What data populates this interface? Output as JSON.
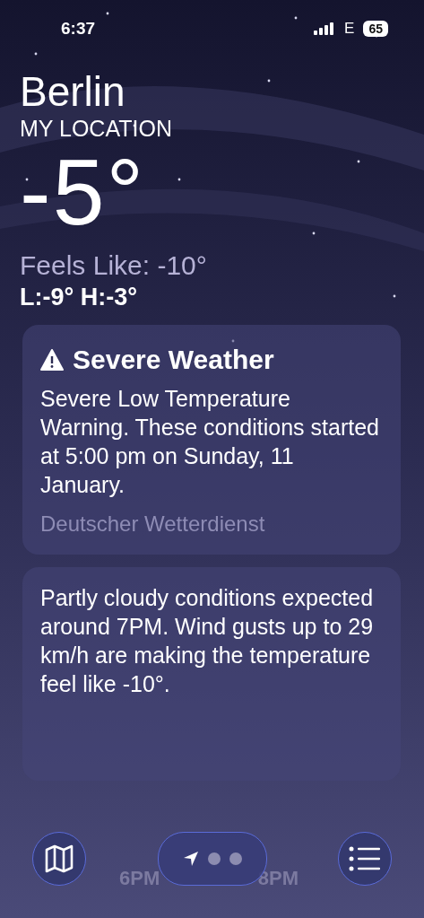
{
  "status_bar": {
    "time": "6:37",
    "network": "E",
    "battery": "65"
  },
  "location": {
    "city": "Berlin",
    "label": "MY LOCATION",
    "temperature": "-5°",
    "feels_like": "Feels Like: -10°",
    "low_high": "L:-9° H:-3°"
  },
  "alert_card": {
    "title": "Severe Weather",
    "text": "Severe Low Temperature Warning. These conditions started at 5:00 pm on Sunday, 11 January.",
    "source": "Deutscher Wetterdienst"
  },
  "forecast_card": {
    "text": "Partly cloudy conditions expected around 7PM. Wind gusts up to 29 km/h are making the temperature feel like -10°.",
    "hours": [
      "6PM",
      "8PM"
    ]
  },
  "page_indicators": [
    {
      "kind": "location",
      "selected": true
    },
    {
      "kind": "dot",
      "selected": false
    },
    {
      "kind": "dot",
      "selected": false
    }
  ]
}
